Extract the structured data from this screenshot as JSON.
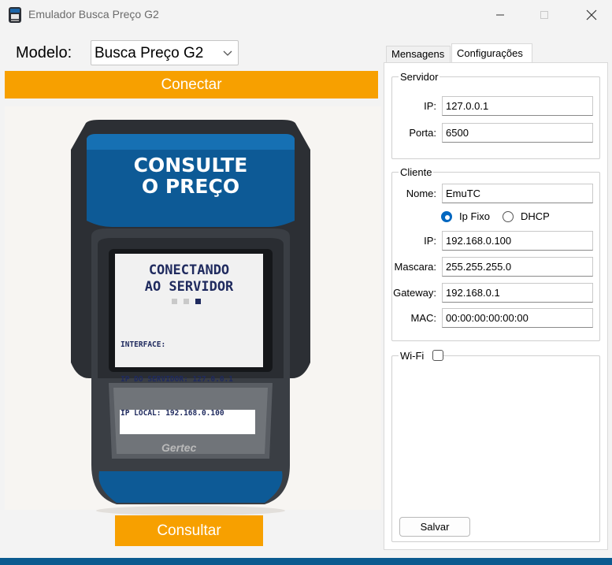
{
  "window": {
    "title": "Emulador Busca Preço G2",
    "icon": "barcode-scanner-icon"
  },
  "left_panel": {
    "modelo_label": "Modelo:",
    "modelo_selected": "Busca Preço G2",
    "conectar_label": "Conectar",
    "consultar_label": "Consultar",
    "device": {
      "banner_line1": "CONSULTE",
      "banner_line2": "O PREÇO",
      "screen_line1": "CONECTANDO",
      "screen_line2": "AO SERVIDOR",
      "info_line1": "INTERFACE:",
      "info_line2": "IP DO SERVIDOR: 127.0.0.1",
      "info_line3": "IP LOCAL: 192.168.0.100",
      "brand": "Gertec"
    }
  },
  "right_panel": {
    "tabs": [
      {
        "label": "Mensagens",
        "active": false
      },
      {
        "label": "Configurações",
        "active": true
      }
    ],
    "servidor": {
      "group_label": "Servidor",
      "ip_label": "IP:",
      "ip_value": "127.0.0.1",
      "porta_label": "Porta:",
      "porta_value": "6500"
    },
    "cliente": {
      "group_label": "Cliente",
      "nome_label": "Nome:",
      "nome_value": "EmuTC",
      "ip_fixo_label": "Ip Fixo",
      "dhcp_label": "DHCP",
      "ip_mode": "Ip Fixo",
      "ip_label": "IP:",
      "ip_value": "192.168.0.100",
      "mascara_label": "Mascara:",
      "mascara_value": "255.255.255.0",
      "gateway_label": "Gateway:",
      "gateway_value": "192.168.0.1",
      "mac_label": "MAC:",
      "mac_value": "00:00:00:00:00:00"
    },
    "wifi": {
      "label": "Wi-Fi",
      "checked": false
    },
    "salvar_label": "Salvar"
  },
  "colors": {
    "accent_orange": "#f7a000",
    "device_blue": "#0d5a96",
    "screen_text": "#1f2a5e",
    "radio_blue": "#0067c0"
  }
}
